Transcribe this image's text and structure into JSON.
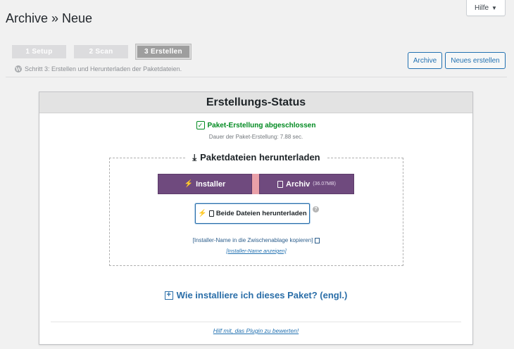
{
  "page": {
    "title": "Archive » Neue"
  },
  "help": {
    "label": "Hilfe",
    "caret": "▼"
  },
  "steps": [
    {
      "label": "1 Setup"
    },
    {
      "label": "2 Scan"
    },
    {
      "label": "3 Erstellen"
    }
  ],
  "step_description": "Schritt 3: Erstellen und Herunterladen der Paketdateien.",
  "top_buttons": {
    "archive": "Archive",
    "new": "Neues erstellen"
  },
  "panel": {
    "title": "Erstellungs-Status",
    "success_text": "Paket-Erstellung abgeschlossen",
    "duration_text": "Dauer der Paket-Erstellung: 7.88 sec.",
    "download_title": "Paketdateien herunterladen",
    "installer_label": "Installer",
    "archiv_label": "Archiv",
    "archiv_size": "(36.07MB)",
    "both_label": "Beide Dateien herunterladen",
    "copy_link": "[Installer-Name in die Zwischenablage kopieren]",
    "show_link": "[Installer-Name anzeigen]",
    "howto": "Wie installiere ich dieses Paket? (engl.)",
    "rate_link": "Hilf mit, das Plugin zu bewerten!"
  },
  "colors": {
    "purple_button": "#6f4a7e",
    "success_green": "#008a20",
    "link_blue": "#2271b1"
  },
  "icons": [
    "wordpress-icon",
    "check-icon",
    "download-icon",
    "bolt-icon",
    "file-icon",
    "copy-icon",
    "help-icon",
    "plus-icon",
    "chevron-down-icon"
  ]
}
